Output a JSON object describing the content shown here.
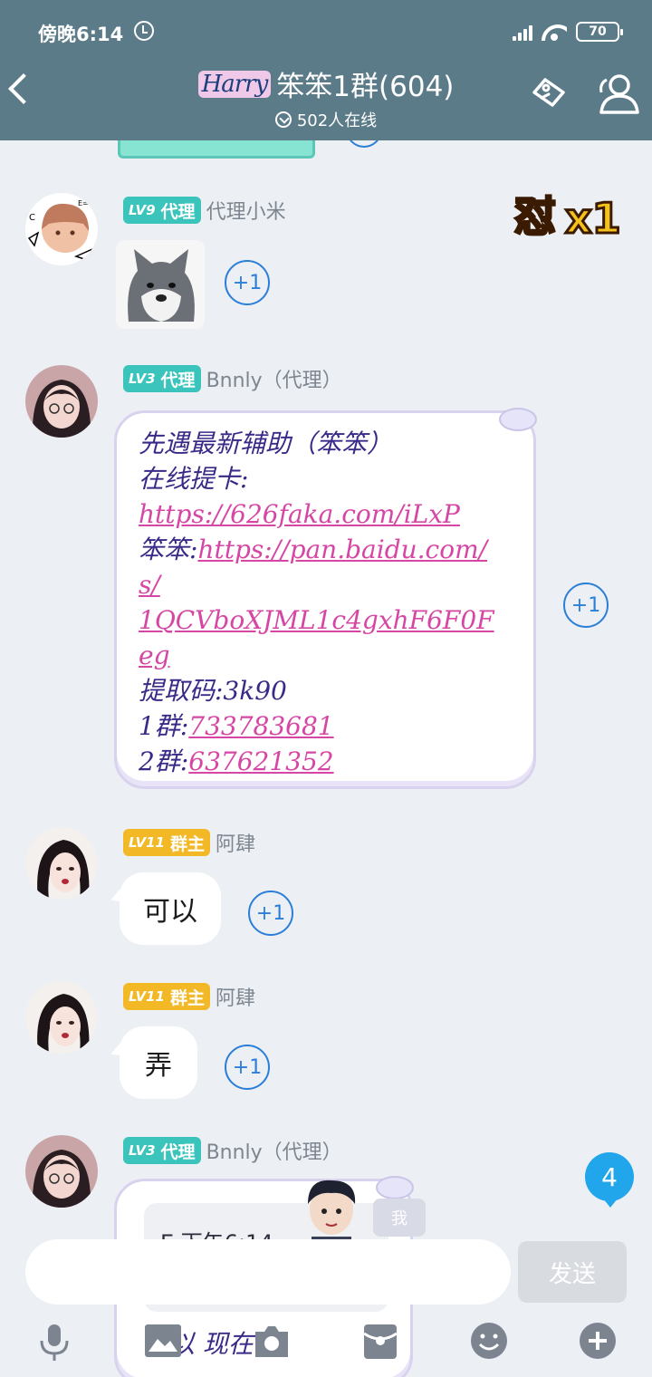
{
  "status_bar": {
    "time": "傍晚6:14",
    "battery": "70"
  },
  "header": {
    "title": "笨笨1群(604)",
    "logo_text": "Harry",
    "online": "502人在线"
  },
  "messages": [
    {
      "badge_level": "LV9",
      "badge_role": "代理",
      "sender": "代理小米",
      "type": "sticker",
      "plus": "+1"
    },
    {
      "badge_level": "LV3",
      "badge_role": "代理",
      "sender": "Bnnly（代理）",
      "type": "card",
      "plus": "+1",
      "lines": {
        "l1": "先遇最新辅助（笨笨）",
        "l2": "在线提卡:",
        "l3": "https://626faka.com/iLxP",
        "l4_label": "笨笨:",
        "l4_link": "https://pan.baidu.com/",
        "l5": "s/",
        "l6": "1QCVboXJML1c4gxhF6F0F",
        "l7": "eg",
        "l8": "提取码:3k90",
        "l9_label": "1群:",
        "l9_link": "733783681",
        "l10_label": "2群:",
        "l10_link": "637621352"
      }
    },
    {
      "badge_level": "LV11",
      "badge_role": "群主",
      "sender": "阿肆",
      "text": "可以",
      "plus": "+1"
    },
    {
      "badge_level": "LV11",
      "badge_role": "群主",
      "sender": "阿肆",
      "text": "弄",
      "plus": "+1"
    },
    {
      "badge_level": "LV3",
      "badge_role": "代理",
      "sender": "Bnnly（代理）",
      "type": "card_partial",
      "quote_time": "E 下午6:14",
      "quote_me": "我",
      "partial_text": "可以 现在"
    }
  ],
  "poke": {
    "label": "怼",
    "count": "x1"
  },
  "unread_count": "4",
  "input": {
    "send_label": "发送"
  },
  "colors": {
    "header": "#5c7b88",
    "accent": "#2b7fd8",
    "teal_badge": "#3bc4bb",
    "gold_badge": "#f2b826",
    "link": "#d646a4"
  }
}
